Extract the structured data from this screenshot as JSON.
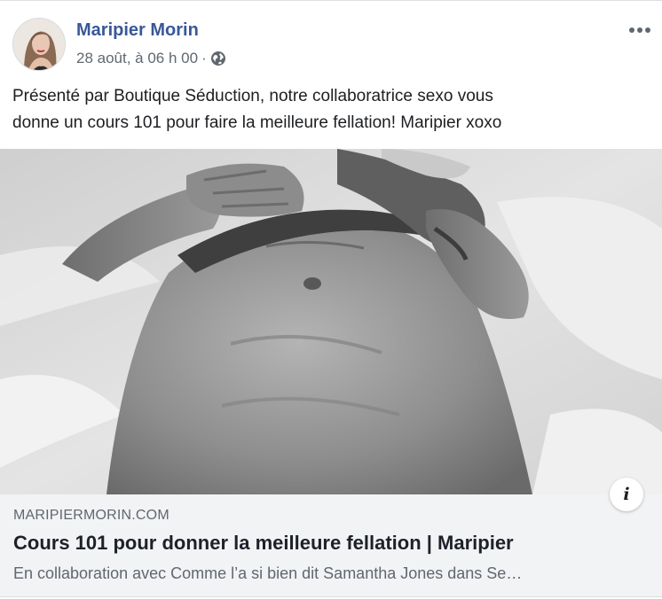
{
  "post": {
    "author": "Maripier Morin",
    "timestamp": "28 août, à 06 h 00",
    "separator": "·",
    "audience_icon": "globe-icon",
    "more_icon": "more-options-icon",
    "text_line1": "Présenté par Boutique Séduction, notre collaboratrice sexo vous",
    "text_line2": "donne un cours 101 pour faire la meilleure fellation! Maripier xoxo"
  },
  "link_preview": {
    "domain": "MARIPIERMORIN.COM",
    "title": "Cours 101 pour donner la meilleure fellation | Maripier",
    "description": "En collaboration avec Comme l’a si bien dit Samantha Jones dans Se…",
    "info_icon_glyph": "i"
  },
  "colors": {
    "author_link": "#385898",
    "meta_text": "#606770",
    "body_text": "#1c1e21",
    "link_box_bg": "#f2f3f5"
  }
}
